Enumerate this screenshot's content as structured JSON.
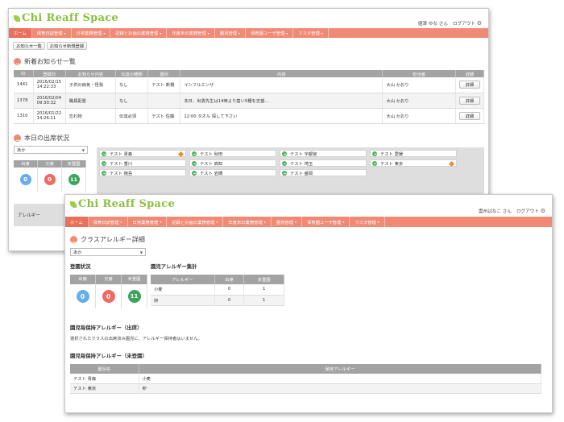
{
  "brand": {
    "name": "Chi Reaff Space"
  },
  "win1": {
    "user_name": "値津 ゆな さん",
    "logout": "ログアウト",
    "nav": [
      {
        "label": "ホーム",
        "home": true,
        "caret": false
      },
      {
        "label": "保育日誌管理",
        "caret": true
      },
      {
        "label": "日常業務管理",
        "caret": true
      },
      {
        "label": "記録と計画の業務管理",
        "caret": true
      },
      {
        "label": "年度末の業務管理",
        "caret": true
      },
      {
        "label": "園児管理",
        "caret": true
      },
      {
        "label": "保育園ユーザ管理",
        "caret": true
      },
      {
        "label": "マスタ管理",
        "caret": true
      }
    ],
    "buttons": {
      "news_list": "お知らせ一覧",
      "news_new": "お知らせ新規登録"
    },
    "news_title": "新着お知らせ一覧",
    "news_table": {
      "headers": [
        "ID",
        "登録日",
        "お知らせ内容",
        "伝達の種類",
        "園児",
        "内容",
        "担当者",
        "詳細"
      ],
      "rows": [
        {
          "id": "1441",
          "date": "2016/02/15",
          "time": "14:22:33",
          "type": "子供の病気・怪我",
          "kind": "なし",
          "child": "テスト 新橋",
          "content": "インフルエンザ",
          "staff": "大山 かおり",
          "btn": "詳細"
        },
        {
          "id": "1378",
          "date": "2016/02/04",
          "time": "09:30:32",
          "type": "職員配置",
          "kind": "なし",
          "child": "",
          "content": "本日、出雲先生は14時より歯い5種を志望...",
          "staff": "大山 かおり",
          "btn": "詳細"
        },
        {
          "id": "1310",
          "date": "2016/01/22",
          "time": "14:26:11",
          "type": "忘れ物",
          "kind": "伝達必須",
          "child": "テスト 佐藤",
          "content": "12:00 タオル 探して下さい",
          "staff": "大山 かおり",
          "btn": "詳細"
        }
      ]
    },
    "attendance_title": "本日の出席状況",
    "class_select": "あか",
    "stats": {
      "present_label": "出席",
      "absent_label": "欠席",
      "unregistered_label": "未登園",
      "present": "0",
      "absent": "0",
      "unregistered": "11"
    },
    "children": [
      {
        "name": "テスト 青森",
        "flag": true
      },
      {
        "name": "テスト 香川",
        "flag": false
      },
      {
        "name": "テスト 徳島",
        "flag": false
      },
      {
        "name": "テスト 秋田",
        "flag": false
      },
      {
        "name": "テスト 高知",
        "flag": false
      },
      {
        "name": "テスト 岩槻",
        "flag": false
      },
      {
        "name": "テスト 宇都宮",
        "flag": false
      },
      {
        "name": "テスト 埼玉",
        "flag": false
      },
      {
        "name": "テスト 盛岡",
        "flag": false
      },
      {
        "name": "テスト 愛媛",
        "flag": false
      },
      {
        "name": "テスト 東京",
        "flag": true
      }
    ],
    "allergy_tab": "アレルギー"
  },
  "win2": {
    "user_name": "雲州はなこ さん",
    "logout": "ログアウト",
    "nav": [
      {
        "label": "ホーム",
        "home": true,
        "caret": false
      },
      {
        "label": "保育日誌管理",
        "caret": true
      },
      {
        "label": "日常業務管理",
        "caret": true
      },
      {
        "label": "記録と計画の業務管理",
        "caret": true
      },
      {
        "label": "年度末の業務管理",
        "caret": true
      },
      {
        "label": "園児管理",
        "caret": true
      },
      {
        "label": "保育園ユーザ管理",
        "caret": true
      },
      {
        "label": "マスタ管理",
        "caret": true
      }
    ],
    "page_title": "クラスアレルギー詳細",
    "class_select": "あか",
    "reg_title": "登園状況",
    "stats": {
      "present_label": "出席",
      "absent_label": "欠席",
      "unregistered_label": "未登園",
      "present": "0",
      "absent": "0",
      "unregistered": "11"
    },
    "summary_title": "園児アレルギー集計",
    "summary_table": {
      "headers": [
        "アレルギー",
        "出席",
        "未登園"
      ],
      "rows": [
        {
          "name": "小麦",
          "present": "0",
          "unregistered": "1"
        },
        {
          "name": "卵",
          "present": "0",
          "unregistered": "1"
        }
      ]
    },
    "present_title": "園児毎保持アレルギー（出席）",
    "present_note": "選択されたクラスの出席済み園児に、アレルギー保持者はいません。",
    "absent_title": "園児毎保持アレルギー（未登園）",
    "absent_table": {
      "headers": [
        "園児名",
        "保持アレルギー"
      ],
      "rows": [
        {
          "name": "テスト 青森",
          "allergy": "小麦"
        },
        {
          "name": "テスト 東京",
          "allergy": "卵"
        }
      ]
    }
  },
  "colors": {
    "nav": "#f08a75",
    "brand": "#8cbf3f",
    "present": "#6aaee8",
    "absent": "#ef6a63",
    "unregistered": "#3ea45c",
    "flag": "#f08a2e"
  }
}
